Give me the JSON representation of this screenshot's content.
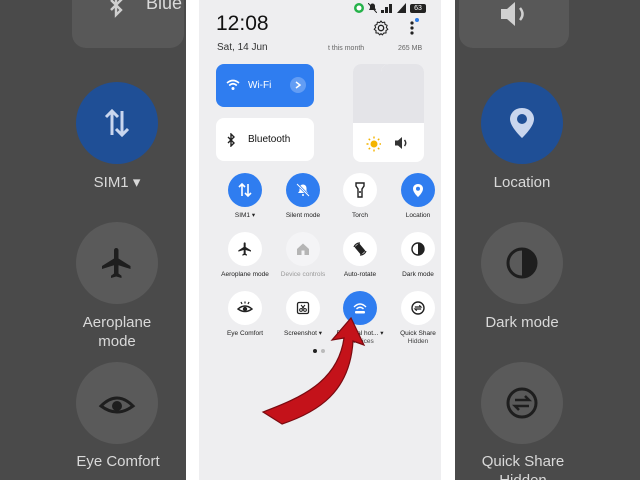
{
  "colors": {
    "accent": "#2f7df0",
    "arrow": "#c4121a"
  },
  "background": {
    "left_labels": [
      "SIM1 ▾",
      "Aeroplane mode",
      "Eye Comfort"
    ],
    "left_top_text": "Blue",
    "right_labels": [
      "Location",
      "Dark mode",
      "Quick Share Hidden"
    ]
  },
  "status": {
    "time": "12:08",
    "date": "Sat, 14 Jun",
    "usage_left": "t this month",
    "usage_right": "265 MB",
    "battery": "63"
  },
  "tiles": {
    "wifi": {
      "label": "Wi-Fi",
      "icon": "wifi-icon"
    },
    "bluetooth": {
      "label": "Bluetooth",
      "icon": "bluetooth-icon"
    }
  },
  "sliders": {
    "brightness_level": 0.4,
    "volume_level": 0.4
  },
  "toggles": [
    {
      "label": "SIM1 ▾",
      "icon": "sim-data-icon",
      "state": "on"
    },
    {
      "label": "Silent mode",
      "icon": "silent-bell-icon",
      "state": "on"
    },
    {
      "label": "Torch",
      "icon": "torch-icon",
      "state": "off"
    },
    {
      "label": "Location",
      "icon": "location-icon",
      "state": "on"
    },
    {
      "label": "Aeroplane mode",
      "icon": "airplane-icon",
      "state": "off"
    },
    {
      "label": "Device controls",
      "icon": "home-icon",
      "state": "disabled"
    },
    {
      "label": "Auto-rotate",
      "icon": "rotate-icon",
      "state": "off"
    },
    {
      "label": "Dark mode",
      "icon": "dark-mode-icon",
      "state": "off"
    },
    {
      "label": "Eye Comfort",
      "icon": "eye-icon",
      "state": "off"
    },
    {
      "label": "Screenshot ▾",
      "icon": "screenshot-icon",
      "state": "off"
    },
    {
      "label": "Personal hot... ▾",
      "sub": "0 devices",
      "icon": "hotspot-icon",
      "state": "on"
    },
    {
      "label": "Quick Share",
      "sub": "Hidden",
      "icon": "quick-share-icon",
      "state": "off"
    }
  ]
}
